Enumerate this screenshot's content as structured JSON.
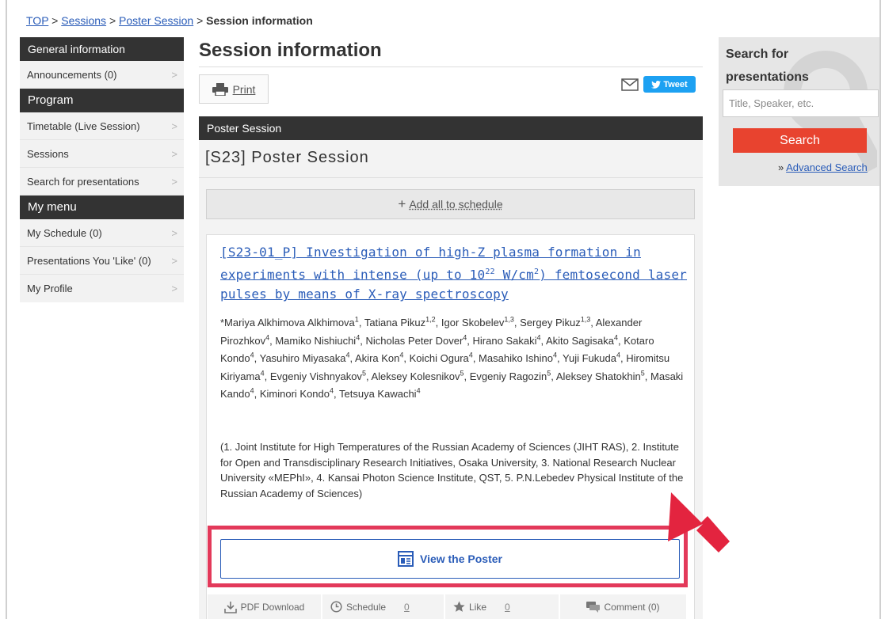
{
  "breadcrumb": {
    "top": "TOP",
    "sep": ">",
    "sessions": "Sessions",
    "poster_session": "Poster Session",
    "current": "Session information"
  },
  "sidebar": {
    "general_head": "General information",
    "announcements": "Announcements (0)",
    "program_head": "Program",
    "timetable": "Timetable (Live Session)",
    "sessions": "Sessions",
    "search_presentations": "Search for presentations",
    "mymenu_head": "My menu",
    "my_schedule": "My Schedule (0)",
    "liked": "Presentations You 'Like' (0)",
    "my_profile": "My Profile",
    "chevron": ">"
  },
  "main": {
    "title": "Session information",
    "print_label": "Print",
    "tweet_label": "Tweet",
    "section_bar": "Poster Session",
    "session_title": "[S23] Poster Session",
    "add_all_label": "Add all to schedule",
    "presentation": {
      "title_part1": "[S23-01_P] Investigation of high-Z plasma formation in experiments with intense (up to 10",
      "title_sup1": "22",
      "title_part2": " W/cm",
      "title_sup2": "2",
      "title_part3": ") femtosecond laser pulses by means of X-ray spectroscopy",
      "affiliations": "(1. Joint Institute for High Temperatures of the Russian Academy of Sciences (JIHT RAS), 2. Institute for Open and Transdisciplinary Research Initiatives, Osaka University, 3. National Research Nuclear University «MEPhI», 4. Kansai Photon Science Institute, QST, 5. P.N.Lebedev Physical Institute of the Russian Academy of Sciences)",
      "view_poster_label": "View the Poster"
    },
    "actions": {
      "pdf": "PDF Download",
      "schedule": "Schedule",
      "schedule_count": "0",
      "like": "Like",
      "like_count": "0",
      "comment": "Comment (0)"
    }
  },
  "authors": [
    {
      "name": "*Mariya Alkhimova Alkhimova",
      "aff": "1"
    },
    {
      "name": "Tatiana Pikuz",
      "aff": "1,2"
    },
    {
      "name": "Igor Skobelev",
      "aff": "1,3"
    },
    {
      "name": "Sergey Pikuz",
      "aff": "1,3"
    },
    {
      "name": "Alexander Pirozhkov",
      "aff": "4"
    },
    {
      "name": "Mamiko Nishiuchi",
      "aff": "4"
    },
    {
      "name": "Nicholas Peter Dover",
      "aff": "4"
    },
    {
      "name": "Hirano Sakaki",
      "aff": "4"
    },
    {
      "name": "Akito Sagisaka",
      "aff": "4"
    },
    {
      "name": "Kotaro Kondo",
      "aff": "4"
    },
    {
      "name": "Yasuhiro Miyasaka",
      "aff": "4"
    },
    {
      "name": "Akira Kon",
      "aff": "4"
    },
    {
      "name": "Koichi Ogura",
      "aff": "4"
    },
    {
      "name": "Masahiko Ishino",
      "aff": "4"
    },
    {
      "name": "Yuji Fukuda",
      "aff": "4"
    },
    {
      "name": "Hiromitsu Kiriyama",
      "aff": "4"
    },
    {
      "name": "Evgeniy Vishnyakov",
      "aff": "5"
    },
    {
      "name": "Aleksey Kolesnikov",
      "aff": "5"
    },
    {
      "name": "Evgeniy Ragozin",
      "aff": "5"
    },
    {
      "name": "Aleksey Shatokhin",
      "aff": "5"
    },
    {
      "name": "Masaki Kando",
      "aff": "4"
    },
    {
      "name": "Kiminori Kondo",
      "aff": "4"
    },
    {
      "name": "Tetsuya Kawachi",
      "aff": "4"
    }
  ],
  "search": {
    "title": "Search for presentations",
    "placeholder": "Title, Speaker, etc.",
    "button": "Search",
    "adv_prefix": "»",
    "advanced": "Advanced Search"
  },
  "colors": {
    "highlight": "#e3395a",
    "search_button": "#e8432f",
    "link": "#2a5cb8",
    "tweet": "#1da1f2"
  }
}
